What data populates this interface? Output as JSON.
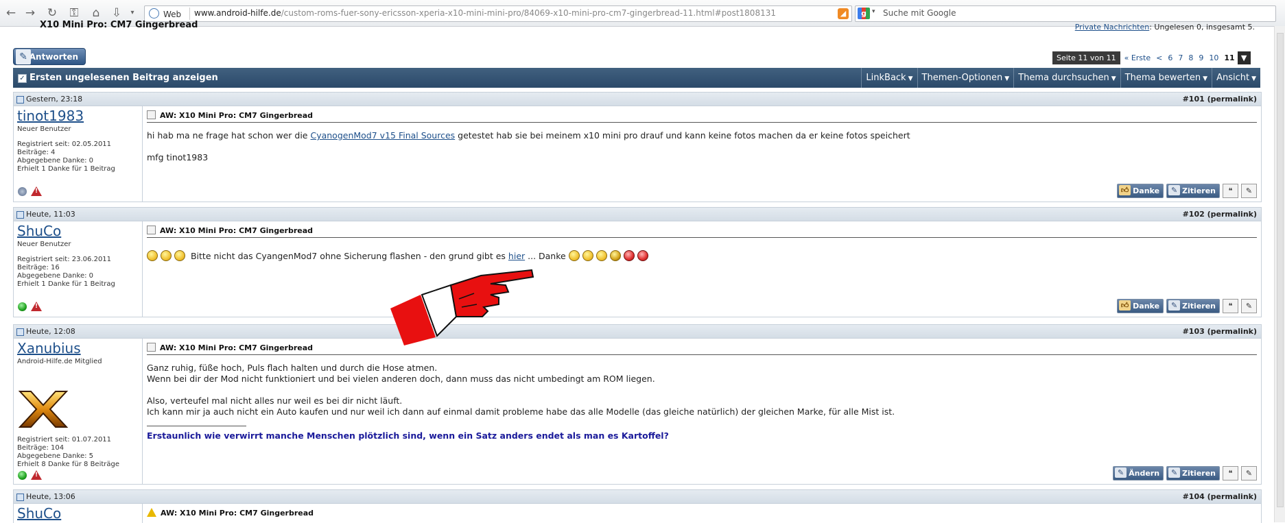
{
  "browser": {
    "web_label": "Web",
    "url_domain": "www.android-hilfe.de",
    "url_path": "/custom-roms-fuer-sony-ericsson-xperia-x10-mini-mini-pro/84069-x10-mini-pro-cm7-gingerbread-11.html#post1808131",
    "search_placeholder": "Suche mit Google"
  },
  "header": {
    "thread_title": "X10 Mini Pro: CM7 Gingerbread",
    "pm_link": "Private Nachrichten",
    "pm_status": ": Ungelesen 0, insgesamt 5."
  },
  "reply_button": "Antworten",
  "pagenav": {
    "label": "Seite 11 von 11",
    "first": "« Erste",
    "prev": "<",
    "pages": [
      "6",
      "7",
      "8",
      "9",
      "10",
      "11"
    ]
  },
  "threadbar": {
    "first_unread": "Ersten ungelesenen Beitrag anzeigen",
    "tools": [
      "LinkBack",
      "Themen-Optionen",
      "Thema durchsuchen",
      "Thema bewerten",
      "Ansicht"
    ]
  },
  "posts": [
    {
      "date": "Gestern, 23:18",
      "number": "#101",
      "permalink": "(permalink)",
      "username": "tinot1983",
      "usertitle": "Neuer Benutzer",
      "stats": [
        "Registriert seit: 02.05.2011",
        "Beiträge: 4",
        "Abgegebene Danke: 0",
        "Erhielt 1 Danke für 1 Beitrag"
      ],
      "title": "AW: X10 Mini Pro: CM7 Gingerbread",
      "line1_a": "hi hab ma ne frage hat schon wer die ",
      "line1_link": "CyanogenMod7 v15 Final Sources",
      "line1_b": " getestet hab sie bei meinem x10 mini pro drauf und kann keine fotos machen da er keine fotos speichert",
      "line2": "mfg tinot1983",
      "btn1": "Danke",
      "btn2": "Zitieren"
    },
    {
      "date": "Heute, 11:03",
      "number": "#102",
      "permalink": "(permalink)",
      "username": "ShuCo",
      "usertitle": "Neuer Benutzer",
      "stats": [
        "Registriert seit: 23.06.2011",
        "Beiträge: 16",
        "Abgegebene Danke: 0",
        "Erhielt 1 Danke für 1 Beitrag"
      ],
      "title": "AW: X10 Mini Pro: CM7 Gingerbread",
      "text_a": "Bitte nicht das CyangenMod7 ohne Sicherung flashen - den grund gibt es ",
      "text_link": "hier",
      "text_b": " ... Danke",
      "btn1": "Danke",
      "btn2": "Zitieren"
    },
    {
      "date": "Heute, 12:08",
      "number": "#103",
      "permalink": "(permalink)",
      "username": "Xanubius",
      "usertitle": "Android-Hilfe.de Mitglied",
      "stats": [
        "Registriert seit: 01.07.2011",
        "Beiträge: 104",
        "Abgegebene Danke: 5",
        "Erhielt 8 Danke für 8 Beiträge"
      ],
      "title": "AW: X10 Mini Pro: CM7 Gingerbread",
      "lines": [
        "Ganz ruhig, füße hoch, Puls flach halten und durch die Hose atmen.",
        "Wenn bei dir der Mod nicht funktioniert und bei vielen anderen doch, dann muss das nicht umbedingt am ROM liegen.",
        "",
        "Also, verteufel mal nicht alles nur weil es bei dir nicht läuft.",
        "Ich kann mir ja auch nicht ein Auto kaufen und nur weil ich dann auf einmal damit probleme habe das alle Modelle (das gleiche natürlich) der gleichen Marke, für alle Mist ist."
      ],
      "signature": "Erstaunlich wie verwirrt manche Menschen plötzlich sind, wenn ein Satz anders endet als man es Kartoffel?",
      "btn1": "Ändern",
      "btn2": "Zitieren"
    },
    {
      "date": "Heute, 13:06",
      "number": "#104",
      "permalink": "(permalink)",
      "username": "ShuCo",
      "title": "AW: X10 Mini Pro: CM7 Gingerbread"
    }
  ]
}
